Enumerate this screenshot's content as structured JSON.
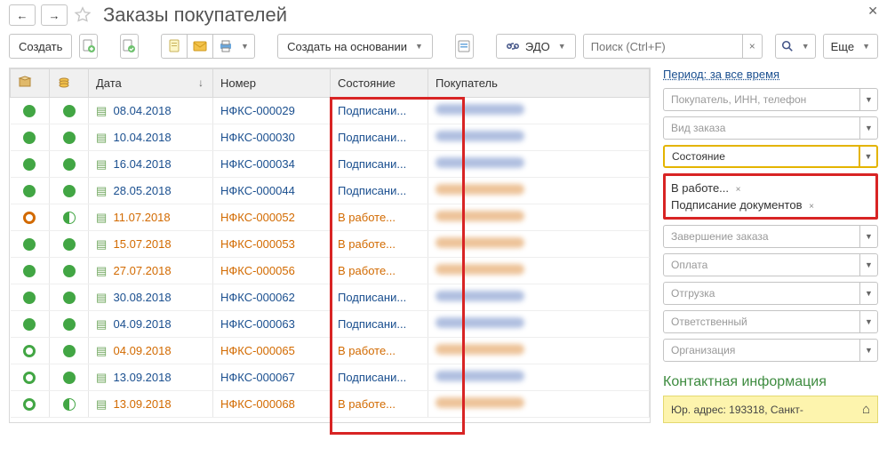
{
  "header": {
    "title": "Заказы покупателей"
  },
  "toolbar": {
    "create": "Создать",
    "create_based": "Создать на основании",
    "edo": "ЭДО",
    "more": "Еще",
    "search_placeholder": "Поиск (Ctrl+F)"
  },
  "columns": {
    "date": "Дата",
    "number": "Номер",
    "state": "Состояние",
    "buyer": "Покупатель"
  },
  "rows": [
    {
      "s1": "fill-green",
      "s2": "fill-green",
      "date": "08.04.2018",
      "num": "НФКС-000029",
      "state": "Подписани...",
      "cls": "blue",
      "buyer": "#3a5fb2"
    },
    {
      "s1": "fill-green",
      "s2": "fill-green",
      "date": "10.04.2018",
      "num": "НФКС-000030",
      "state": "Подписани...",
      "cls": "blue",
      "buyer": "#3a5fb2"
    },
    {
      "s1": "fill-green",
      "s2": "fill-green",
      "date": "16.04.2018",
      "num": "НФКС-000034",
      "state": "Подписани...",
      "cls": "blue",
      "buyer": "#3a5fb2"
    },
    {
      "s1": "fill-green",
      "s2": "fill-green",
      "date": "28.05.2018",
      "num": "НФКС-000044",
      "state": "Подписани...",
      "cls": "blue",
      "buyer": "#d26a00"
    },
    {
      "s1": "ring-orange",
      "s2": "moon",
      "date": "11.07.2018",
      "num": "НФКС-000052",
      "state": "В работе...",
      "cls": "orange",
      "buyer": "#d26a00"
    },
    {
      "s1": "fill-green",
      "s2": "fill-green",
      "date": "15.07.2018",
      "num": "НФКС-000053",
      "state": "В работе...",
      "cls": "orange",
      "buyer": "#d26a00"
    },
    {
      "s1": "fill-green",
      "s2": "fill-green",
      "date": "27.07.2018",
      "num": "НФКС-000056",
      "state": "В работе...",
      "cls": "orange",
      "buyer": "#d26a00"
    },
    {
      "s1": "fill-green",
      "s2": "fill-green",
      "date": "30.08.2018",
      "num": "НФКС-000062",
      "state": "Подписани...",
      "cls": "blue",
      "buyer": "#3a5fb2"
    },
    {
      "s1": "fill-green",
      "s2": "fill-green",
      "date": "04.09.2018",
      "num": "НФКС-000063",
      "state": "Подписани...",
      "cls": "blue",
      "buyer": "#3a5fb2"
    },
    {
      "s1": "ring-green",
      "s2": "fill-green",
      "date": "04.09.2018",
      "num": "НФКС-000065",
      "state": "В работе...",
      "cls": "orange",
      "buyer": "#d26a00"
    },
    {
      "s1": "ring-green",
      "s2": "fill-green",
      "date": "13.09.2018",
      "num": "НФКС-000067",
      "state": "Подписани...",
      "cls": "blue",
      "buyer": "#3a5fb2"
    },
    {
      "s1": "ring-green",
      "s2": "moon",
      "date": "13.09.2018",
      "num": "НФКС-000068",
      "state": "В работе...",
      "cls": "orange",
      "buyer": "#d26a00"
    }
  ],
  "sidebar": {
    "period": "Период: за все время",
    "filters": {
      "buyer_ph": "Покупатель, ИНН, телефон",
      "order_type_ph": "Вид заказа",
      "state_ph": "Состояние",
      "completion_ph": "Завершение заказа",
      "payment_ph": "Оплата",
      "shipping_ph": "Отгрузка",
      "responsible_ph": "Ответственный",
      "org_ph": "Организация"
    },
    "tags": {
      "t1": "В работе...",
      "t2": "Подписание документов"
    },
    "contact_header": "Контактная информация",
    "contact_addr": "Юр. адрес: 193318, Санкт-"
  }
}
